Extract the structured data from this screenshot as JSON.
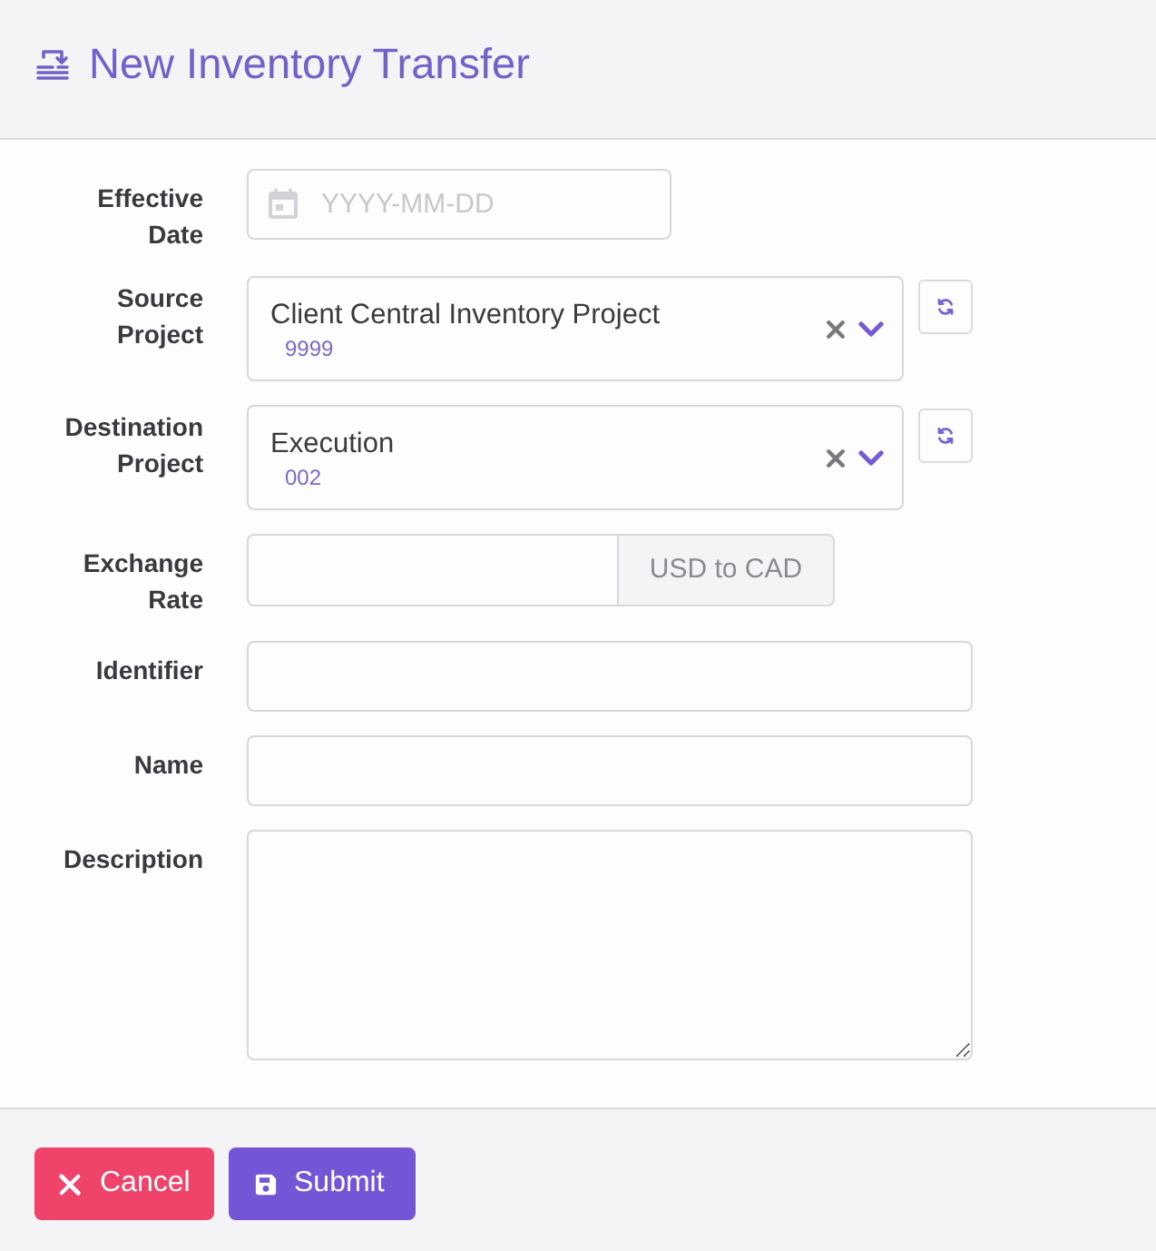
{
  "header": {
    "title": "New Inventory Transfer"
  },
  "fields": [
    {
      "kind": "date",
      "label": "Effective Date",
      "placeholder": "YYYY-MM-DD"
    },
    {
      "kind": "select",
      "label": "Source Project",
      "value": "Client Central Inventory Project",
      "code": "9999"
    },
    {
      "kind": "select",
      "label": "Destination Project",
      "value": "Execution",
      "code": "002"
    },
    {
      "kind": "addon",
      "label": "Exchange Rate",
      "addon": "USD to CAD"
    },
    {
      "kind": "text",
      "label": "Identifier"
    },
    {
      "kind": "text",
      "label": "Name"
    },
    {
      "kind": "textarea",
      "label": "Description"
    }
  ],
  "footer": {
    "buttons": [
      {
        "kind": "cancel",
        "label": "Cancel"
      },
      {
        "kind": "submit",
        "label": "Submit"
      }
    ]
  }
}
